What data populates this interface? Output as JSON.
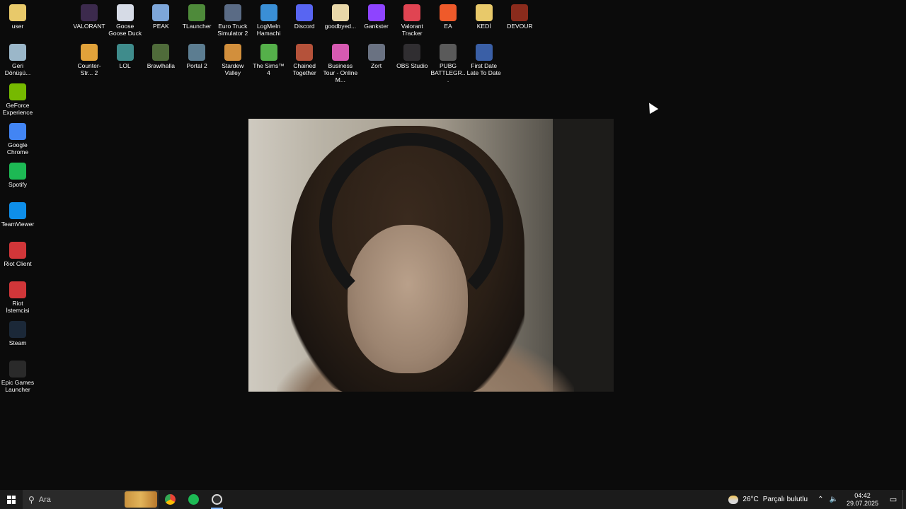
{
  "desktop_icons_left": [
    {
      "label": "user",
      "icon": "folder-icon",
      "color": "#e8c96a"
    },
    {
      "label": "Geri Dönüşü...",
      "icon": "recycle-bin-icon",
      "color": "#9bb7c9"
    },
    {
      "label": "GeForce Experience",
      "icon": "geforce-icon",
      "color": "#76b900"
    },
    {
      "label": "Google Chrome",
      "icon": "chrome-icon",
      "color": "#4285f4"
    },
    {
      "label": "Spotify",
      "icon": "spotify-icon",
      "color": "#1db954"
    },
    {
      "label": "TeamViewer",
      "icon": "teamviewer-icon",
      "color": "#0e8ee9"
    },
    {
      "label": "Riot Client",
      "icon": "riot-icon",
      "color": "#d13639"
    },
    {
      "label": "Riot İstemcisi",
      "icon": "riot-icon",
      "color": "#d13639"
    },
    {
      "label": "Steam",
      "icon": "steam-icon",
      "color": "#1b2838"
    },
    {
      "label": "Epic Games Launcher",
      "icon": "epic-icon",
      "color": "#2a2a2a"
    }
  ],
  "desktop_icons_row1": [
    {
      "label": "VALORANT",
      "icon": "valorant-icon",
      "color": "#3c2a4d"
    },
    {
      "label": "Goose Goose Duck",
      "icon": "goose-icon",
      "color": "#d6dbe6"
    },
    {
      "label": "PEAK",
      "icon": "peak-icon",
      "color": "#7da6d9"
    },
    {
      "label": "TLauncher",
      "icon": "tlauncher-icon",
      "color": "#4e8a3a"
    },
    {
      "label": "Euro Truck Simulator 2",
      "icon": "truck-icon",
      "color": "#5a6b85"
    },
    {
      "label": "LogMeIn Hamachi",
      "icon": "hamachi-icon",
      "color": "#3a8fd6"
    },
    {
      "label": "Discord",
      "icon": "discord-icon",
      "color": "#5865f2"
    },
    {
      "label": "goodbyed...",
      "icon": "file-icon",
      "color": "#e8d7a8"
    },
    {
      "label": "Gankster",
      "icon": "gankster-icon",
      "color": "#8e44ff"
    },
    {
      "label": "Valorant Tracker",
      "icon": "tracker-icon",
      "color": "#e04452"
    },
    {
      "label": "EA",
      "icon": "ea-icon",
      "color": "#ef5a2a"
    },
    {
      "label": "KEDİ",
      "icon": "folder-icon",
      "color": "#e8c96a"
    },
    {
      "label": "DEVOUR",
      "icon": "devour-icon",
      "color": "#8a2b1c"
    }
  ],
  "desktop_icons_row2": [
    {
      "label": "Counter-Str... 2",
      "icon": "cs2-icon",
      "color": "#e1a23a"
    },
    {
      "label": "LOL",
      "icon": "lol-icon",
      "color": "#3f8c8c"
    },
    {
      "label": "Brawlhalla",
      "icon": "brawlhalla-icon",
      "color": "#4f6b3a"
    },
    {
      "label": "Portal 2",
      "icon": "portal-icon",
      "color": "#5c7d91"
    },
    {
      "label": "Stardew Valley",
      "icon": "stardew-icon",
      "color": "#d28f3c"
    },
    {
      "label": "The Sims™ 4",
      "icon": "sims-icon",
      "color": "#55b04a"
    },
    {
      "label": "Chained Together",
      "icon": "chained-icon",
      "color": "#b5523a"
    },
    {
      "label": "Business Tour - Online M...",
      "icon": "business-tour-icon",
      "color": "#d65ab1"
    },
    {
      "label": "Zort",
      "icon": "zort-icon",
      "color": "#6a7282"
    },
    {
      "label": "OBS Studio",
      "icon": "obs-icon",
      "color": "#302e31"
    },
    {
      "label": "PUBG BATTLEGR...",
      "icon": "pubg-icon",
      "color": "#5a5a5a"
    },
    {
      "label": "First Date Late To Date",
      "icon": "first-date-icon",
      "color": "#3a5fa6"
    }
  ],
  "taskbar": {
    "search_placeholder": "Ara",
    "pinned": [
      {
        "name": "chrome",
        "color": "#4285f4"
      },
      {
        "name": "spotify",
        "color": "#1db954"
      },
      {
        "name": "obs",
        "color": "#d9d9d9"
      }
    ],
    "weather_temp": "26°C",
    "weather_condition": "Parçalı bulutlu",
    "time": "04:42",
    "date": "29.07.2025"
  }
}
